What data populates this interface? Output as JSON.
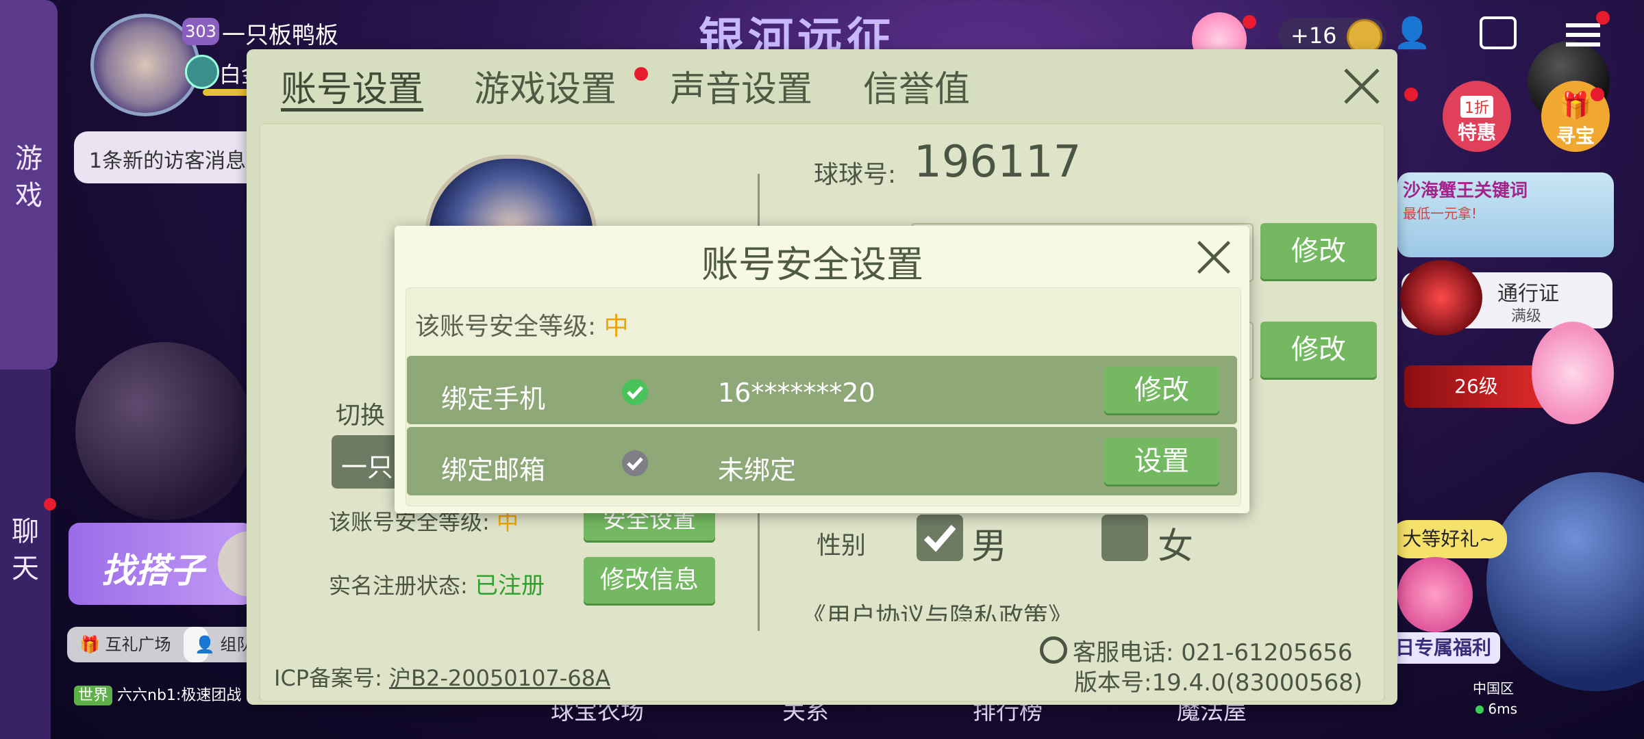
{
  "background": {
    "game_title": "银河远征",
    "player": {
      "level": "303",
      "name": "一只板鸭板",
      "rank": "白金"
    },
    "visitor_notice": "1条新的访客消息",
    "side_tabs": {
      "game": "游\n戏",
      "chat": "聊\n天"
    },
    "find_partner": "找搭子",
    "bottom_chips": [
      "互礼广场",
      "组队"
    ],
    "world_chat": {
      "tag": "世界",
      "text": "六六nb1:极速团战"
    },
    "coin_display": "+16",
    "right_promos": {
      "special": "特惠",
      "discount": "1折",
      "treasure": "寻宝",
      "event_title": "沙海蟹王关键词",
      "event_sub": "最低一元拿!",
      "pass": "通行证",
      "pass_sub": "满级",
      "level_badge": "26级",
      "gift_text": "大等好礼~",
      "welfare": "日专属福利"
    },
    "region": "中国区",
    "ping": "6ms",
    "bottom_nav": [
      "球宝农场",
      "关系",
      "排行榜",
      "魔法屋"
    ]
  },
  "settings": {
    "tabs": [
      {
        "label": "账号设置",
        "active": true
      },
      {
        "label": "游戏设置",
        "active": false,
        "dot": true
      },
      {
        "label": "声音设置",
        "active": false
      },
      {
        "label": "信誉值",
        "active": false
      }
    ],
    "qq_label": "球球号:",
    "qq_number": "196117",
    "modify_btn_1": "修改",
    "modify_btn_2": "修改",
    "switch_label": "切换",
    "switch_account_short": "一只",
    "security_level_label": "该账号安全等级:",
    "security_level_value": "中",
    "security_btn": "安全设置",
    "realname_label": "实名注册状态:",
    "realname_value": "已注册",
    "realname_btn": "修改信息",
    "gender_label": "性别",
    "gender_male": "男",
    "gender_female": "女",
    "agreement_link": "《用户协议与隐私政策》",
    "icp_label": "ICP备案号:",
    "icp_value": "沪B2-20050107-68A",
    "service_phone": "客服电话: 021-61205656",
    "version": "版本号:19.4.0(83000568)"
  },
  "dialog": {
    "title": "账号安全设置",
    "level_label": "该账号安全等级:",
    "level_value": "中",
    "rows": [
      {
        "label": "绑定手机",
        "status": "bound",
        "value": "16*******20",
        "button": "修改"
      },
      {
        "label": "绑定邮箱",
        "status": "unbound",
        "value": "未绑定",
        "button": "设置"
      }
    ]
  },
  "colors": {
    "accent_green": "#74b861",
    "level_orange": "#f0a500",
    "registered_green": "#2fa12f",
    "panel_bg": "#d7ddbf"
  }
}
